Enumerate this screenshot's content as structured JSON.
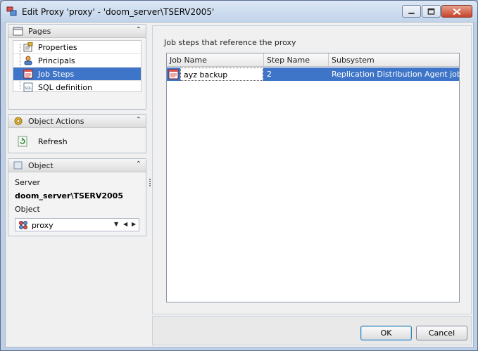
{
  "window": {
    "title": "Edit Proxy 'proxy' - 'doom_server\\TSERV2005'"
  },
  "sidebar": {
    "pages": {
      "title": "Pages",
      "items": [
        {
          "label": "Properties",
          "icon": "properties-icon",
          "selected": false
        },
        {
          "label": "Principals",
          "icon": "principals-icon",
          "selected": false
        },
        {
          "label": "Job Steps",
          "icon": "job-steps-icon",
          "selected": true
        },
        {
          "label": "SQL definition",
          "icon": "sql-icon",
          "selected": false
        }
      ]
    },
    "actions": {
      "title": "Object Actions",
      "items": [
        {
          "label": "Refresh",
          "icon": "refresh-icon"
        }
      ]
    },
    "object": {
      "title": "Object",
      "server_label": "Server",
      "server_value": "doom_server\\TSERV2005",
      "object_label": "Object",
      "object_value": "proxy"
    }
  },
  "main": {
    "caption": "Job steps that reference the proxy",
    "columns": [
      "Job Name",
      "Step Name",
      "Subsystem"
    ],
    "rows": [
      {
        "job_name": "ayz backup",
        "step_name": "2",
        "subsystem": "Replication Distribution Agent job"
      }
    ]
  },
  "footer": {
    "ok_label": "OK",
    "cancel_label": "Cancel"
  },
  "colors": {
    "selection": "#3f75c8",
    "window_frame": "#bfd0e6",
    "close_button": "#c7432a"
  }
}
